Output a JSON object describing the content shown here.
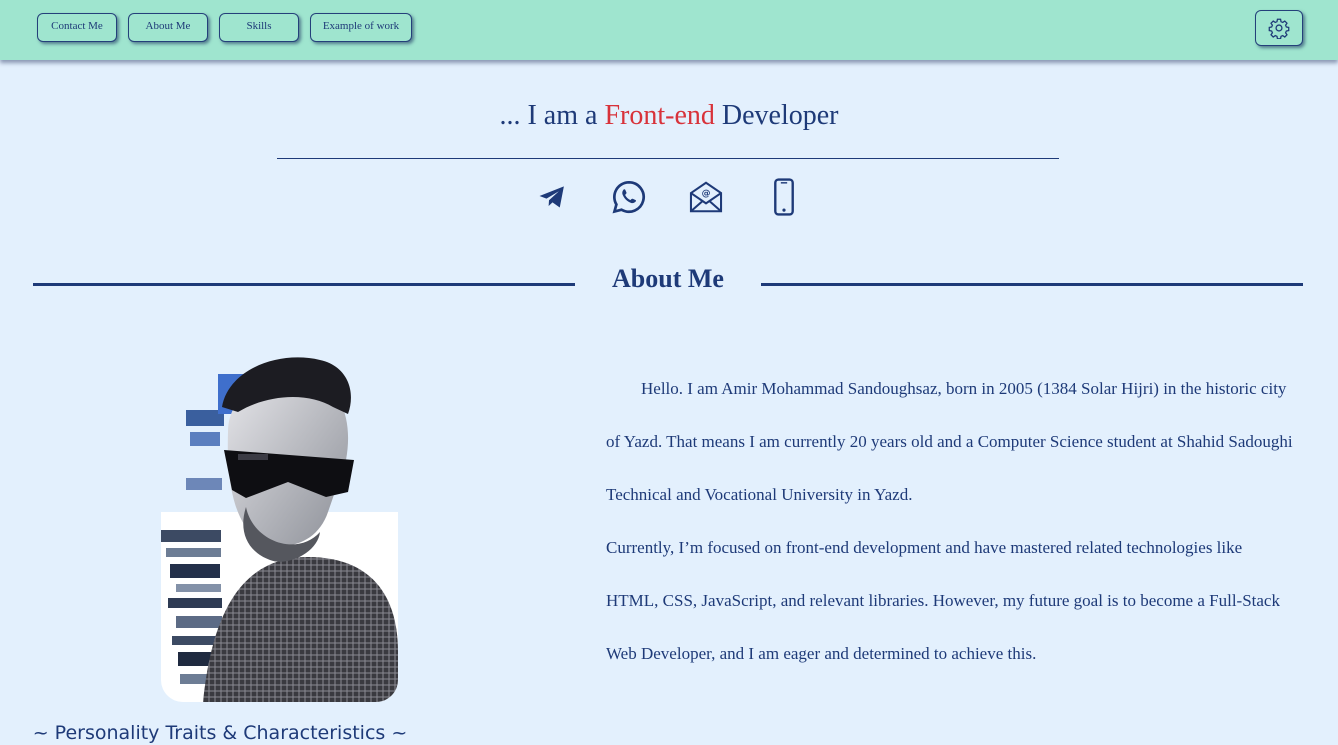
{
  "nav": {
    "items": [
      {
        "label": "Contact Me"
      },
      {
        "label": "About Me"
      },
      {
        "label": "Skills"
      },
      {
        "label": "Example of work"
      }
    ],
    "settings_icon": "gear-icon"
  },
  "hero": {
    "prefix": "... I am a ",
    "accent": "Front-end",
    "suffix": " Developer",
    "accent_color": "#d8323a"
  },
  "contacts": [
    {
      "icon": "telegram-icon"
    },
    {
      "icon": "whatsapp-icon"
    },
    {
      "icon": "email-icon"
    },
    {
      "icon": "phone-icon"
    }
  ],
  "about": {
    "title": "About Me",
    "paragraph1": "Hello. I am Amir Mohammad Sandoughsaz, born in 2005 (1384 Solar Hijri) in the historic city of Yazd. That means I am currently 20 years old and a Computer Science student at Shahid Sadoughi Technical and Vocational University in Yazd.",
    "paragraph2": "Currently, I’m focused on front-end development and have mastered related technologies like HTML, CSS, JavaScript, and relevant libraries. However, my future goal is to become a Full-Stack Web Developer, and I am eager and determined to achieve this.",
    "traits_heading": "~ Personality Traits & Characteristics ~"
  },
  "colors": {
    "topbar": "#9fe5cf",
    "background": "#e3f0fd",
    "primary": "#1e3a78",
    "accent": "#d8323a"
  }
}
